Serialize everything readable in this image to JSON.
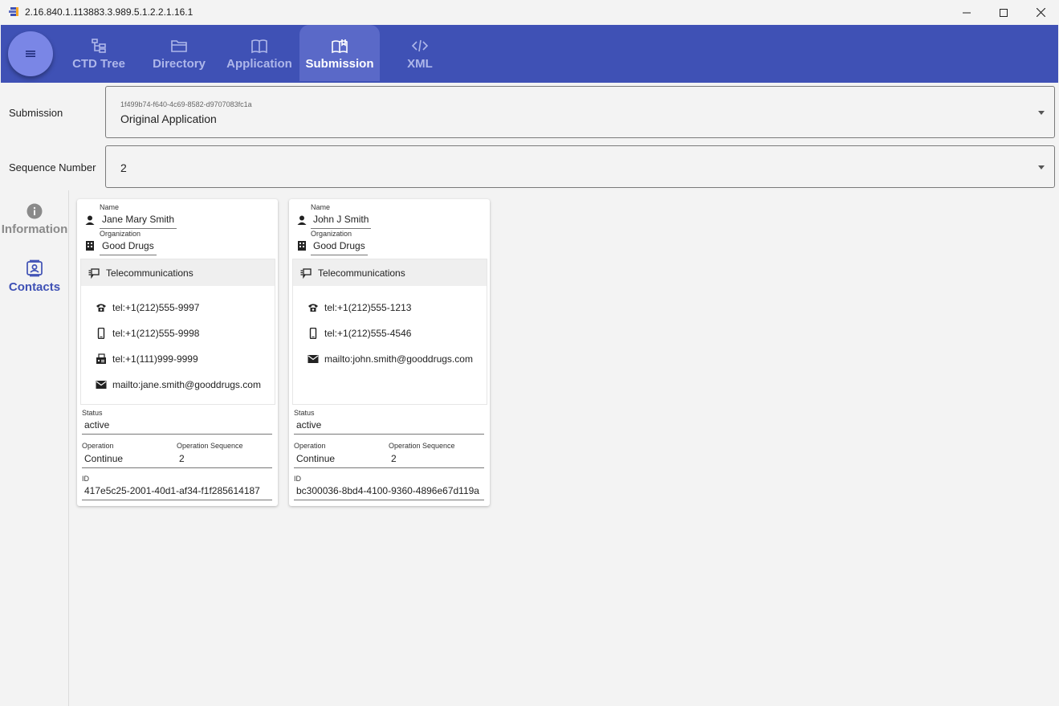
{
  "window": {
    "title": "2.16.840.1.113883.3.989.5.1.2.2.1.16.1"
  },
  "nav": {
    "tabs": [
      {
        "label": "CTD Tree",
        "icon": "tree-icon"
      },
      {
        "label": "Directory",
        "icon": "folder-icon"
      },
      {
        "label": "Application",
        "icon": "book-icon"
      },
      {
        "label": "Submission",
        "icon": "book-open-icon"
      },
      {
        "label": "XML",
        "icon": "code-icon"
      }
    ],
    "active": "Submission"
  },
  "form": {
    "submission_label": "Submission",
    "submission_hint": "1f499b74-f640-4c69-8582-d9707083fc1a",
    "submission_value": "Original Application",
    "sequence_label": "Sequence Number",
    "sequence_value": "2"
  },
  "rail": {
    "items": [
      {
        "label": "Information",
        "icon": "info-icon"
      },
      {
        "label": "Contacts",
        "icon": "contact-card-icon"
      }
    ],
    "active": "Contacts"
  },
  "labels": {
    "name": "Name",
    "organization": "Organization",
    "telecom": "Telecommunications",
    "status": "Status",
    "operation": "Operation",
    "operation_sequence": "Operation Sequence",
    "id": "ID"
  },
  "contacts": [
    {
      "name": "Jane Mary Smith",
      "organization": "Good Drugs",
      "telecoms": [
        {
          "icon": "phone-icon",
          "value": "tel:+1(212)555-9997"
        },
        {
          "icon": "mobile-icon",
          "value": "tel:+1(212)555-9998"
        },
        {
          "icon": "fax-icon",
          "value": "tel:+1(111)999-9999"
        },
        {
          "icon": "email-icon",
          "value": "mailto:jane.smith@gooddrugs.com"
        }
      ],
      "status": "active",
      "operation": "Continue",
      "operation_sequence": "2",
      "id": "417e5c25-2001-40d1-af34-f1f285614187"
    },
    {
      "name": "John J Smith",
      "organization": "Good Drugs",
      "telecoms": [
        {
          "icon": "phone-icon",
          "value": "tel:+1(212)555-1213"
        },
        {
          "icon": "mobile-icon",
          "value": "tel:+1(212)555-4546"
        },
        {
          "icon": "email-icon",
          "value": "mailto:john.smith@gooddrugs.com"
        }
      ],
      "status": "active",
      "operation": "Continue",
      "operation_sequence": "2",
      "id": "bc300036-8bd4-4100-9360-4896e67d119a"
    }
  ],
  "colors": {
    "navbar": "#3f51b5",
    "nav_active": "#5a69c8",
    "fab": "#7a86e6",
    "rail_active": "#3f51b5",
    "rail_inactive": "#8a8a8a"
  }
}
